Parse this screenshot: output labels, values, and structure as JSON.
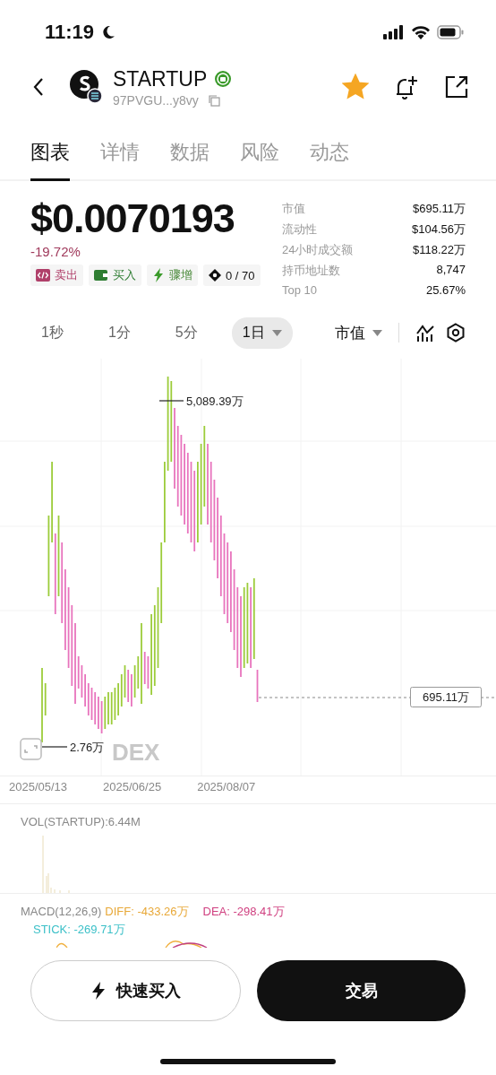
{
  "status_bar": {
    "time": "11:19"
  },
  "token": {
    "name": "STARTUP",
    "address": "97PVGU...y8vy",
    "favorited": true
  },
  "tabs": [
    {
      "label": "图表",
      "selected": true
    },
    {
      "label": "详情",
      "selected": false
    },
    {
      "label": "数据",
      "selected": false
    },
    {
      "label": "风险",
      "selected": false
    },
    {
      "label": "动态",
      "selected": false
    }
  ],
  "price": {
    "value": "$0.0070193",
    "change": "-19.72%"
  },
  "tags": [
    {
      "kind": "sell",
      "label": "卖出"
    },
    {
      "kind": "buy",
      "label": "买入"
    },
    {
      "kind": "surge",
      "label": "骤增"
    },
    {
      "kind": "target",
      "label": "0 / 70"
    }
  ],
  "stats": [
    {
      "label": "市值",
      "value": "$695.11万"
    },
    {
      "label": "流动性",
      "value": "$104.56万"
    },
    {
      "label": "24小时成交额",
      "value": "$118.22万"
    },
    {
      "label": "持币地址数",
      "value": "8,747"
    },
    {
      "label": "Top 10",
      "value": "25.67%"
    }
  ],
  "intervals": [
    {
      "label": "1秒",
      "selected": false
    },
    {
      "label": "1分",
      "selected": false
    },
    {
      "label": "5分",
      "selected": false
    },
    {
      "label": "1日",
      "selected": true
    }
  ],
  "metric_dropdown": "市值",
  "chart": {
    "high_label": "5,089.39万",
    "low_label": "2.76万",
    "last_label": "695.11万",
    "watermark": "DEX",
    "dates": [
      "2025/05/13",
      "2025/06/25",
      "2025/08/07"
    ]
  },
  "volume": {
    "label": "VOL(STARTUP):6.44M"
  },
  "macd": {
    "label": "MACD(12,26,9)",
    "diff": "DIFF: -433.26万",
    "dea": "DEA: -298.41万",
    "stick": "STICK: -269.71万"
  },
  "buttons": [
    {
      "kind": "quick",
      "label": "快速买入"
    },
    {
      "kind": "trade",
      "label": "交易"
    }
  ]
}
